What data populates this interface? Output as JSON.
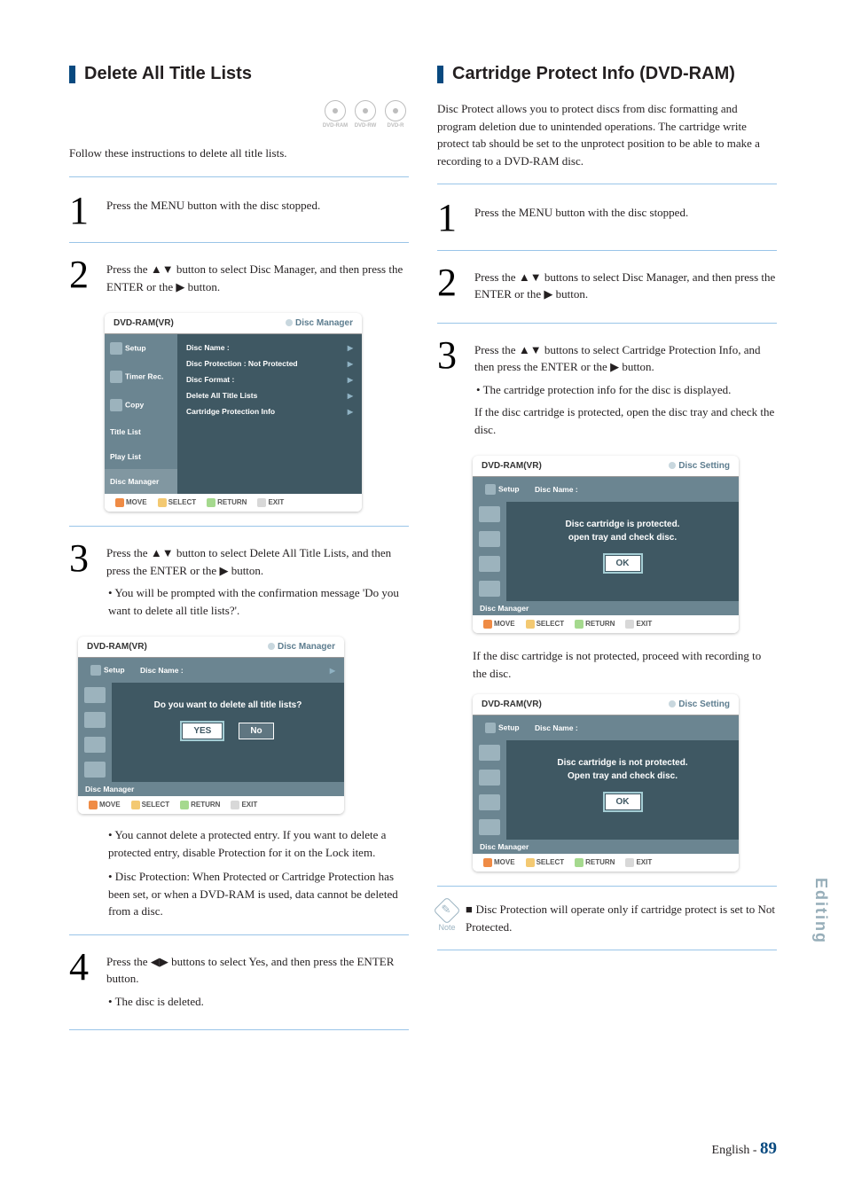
{
  "left": {
    "heading": "Delete All Title Lists",
    "badges": [
      "DVD-RAM",
      "DVD-RW",
      "DVD-R"
    ],
    "intro": "Follow these instructions to delete all title lists.",
    "steps": {
      "s1": "Press the MENU button with the disc stopped.",
      "s2": "Press the ▲▼ button to select Disc Manager, and then press the ENTER or the ▶ button.",
      "s3_p1": "Press the ▲▼ button to select Delete All Title Lists, and then press the ENTER or the ▶ button.",
      "s3_b1": "• You will be prompted with the confirmation message 'Do you want to delete all title lists?'.",
      "s3_b2": "• You cannot delete a protected entry. If you want to delete a protected entry, disable Protection for it on the Lock item.",
      "s3_b3": "• Disc Protection: When Protected or Cartridge Protection has been set, or when a DVD-RAM is used, data cannot be deleted from a disc.",
      "s4_p1": "Press the ◀▶ buttons to select Yes, and then press the ENTER button.",
      "s4_b1": "• The disc is deleted."
    },
    "ui1": {
      "header_l": "DVD-RAM(VR)",
      "header_r": "Disc Manager",
      "side": [
        "Setup",
        "Timer Rec.",
        "Copy",
        "Title List",
        "Play List",
        "Disc Manager"
      ],
      "rows": {
        "r1": "Disc Name   :",
        "r2": "Disc Protection : Not Protected",
        "r3": "Disc Format  :",
        "r4": "Delete All Title Lists",
        "r5": "Cartridge Protection Info"
      },
      "footer": {
        "move": "MOVE",
        "select": "SELECT",
        "return": "RETURN",
        "exit": "EXIT"
      }
    },
    "ui2": {
      "header_l": "DVD-RAM(VR)",
      "header_r": "Disc Manager",
      "top": "Disc Name   :",
      "setup": "Setup",
      "msg": "Do you want to delete all title lists?",
      "yes": "YES",
      "no": "No",
      "dm": "Disc Manager",
      "footer": {
        "move": "MOVE",
        "select": "SELECT",
        "return": "RETURN",
        "exit": "EXIT"
      }
    }
  },
  "right": {
    "heading": "Cartridge Protect Info (DVD-RAM)",
    "intro": "Disc Protect allows you to protect discs from disc formatting and program deletion due to unintended operations. The cartridge write protect tab should be set to the unprotect position to be able to make a recording to a DVD-RAM disc.",
    "steps": {
      "s1": "Press the MENU button with the disc stopped.",
      "s2": "Press the ▲▼ buttons to select Disc Manager, and then press the ENTER or the ▶ button.",
      "s3_p1": "Press the ▲▼ buttons to select Cartridge Protection Info, and then press the ENTER or the ▶ button.",
      "s3_b1": "• The cartridge protection info for the disc is displayed.",
      "s3_p2": "If the disc cartridge is protected, open the disc tray and check the disc.",
      "after_ui1": "If the disc cartridge is not protected, proceed with recording to the disc."
    },
    "ui1": {
      "header_l": "DVD-RAM(VR)",
      "header_r": "Disc Setting",
      "top": "Disc Name   :",
      "setup": "Setup",
      "msg1": "Disc cartridge is protected.",
      "msg2": "open tray and check disc.",
      "ok": "OK",
      "dm": "Disc Manager",
      "footer": {
        "move": "MOVE",
        "select": "SELECT",
        "return": "RETURN",
        "exit": "EXIT"
      }
    },
    "ui2": {
      "header_l": "DVD-RAM(VR)",
      "header_r": "Disc Setting",
      "top": "Disc Name   :",
      "setup": "Setup",
      "msg1": "Disc cartridge is not protected.",
      "msg2": "Open tray and check disc.",
      "ok": "OK",
      "dm": "Disc Manager",
      "footer": {
        "move": "MOVE",
        "select": "SELECT",
        "return": "RETURN",
        "exit": "EXIT"
      }
    },
    "note": "Disc Protection will operate only if cartridge protect is set to Not Protected.",
    "note_label": "Note"
  },
  "sidetab": "Editing",
  "footer": {
    "lang": "English - ",
    "page": "89"
  }
}
